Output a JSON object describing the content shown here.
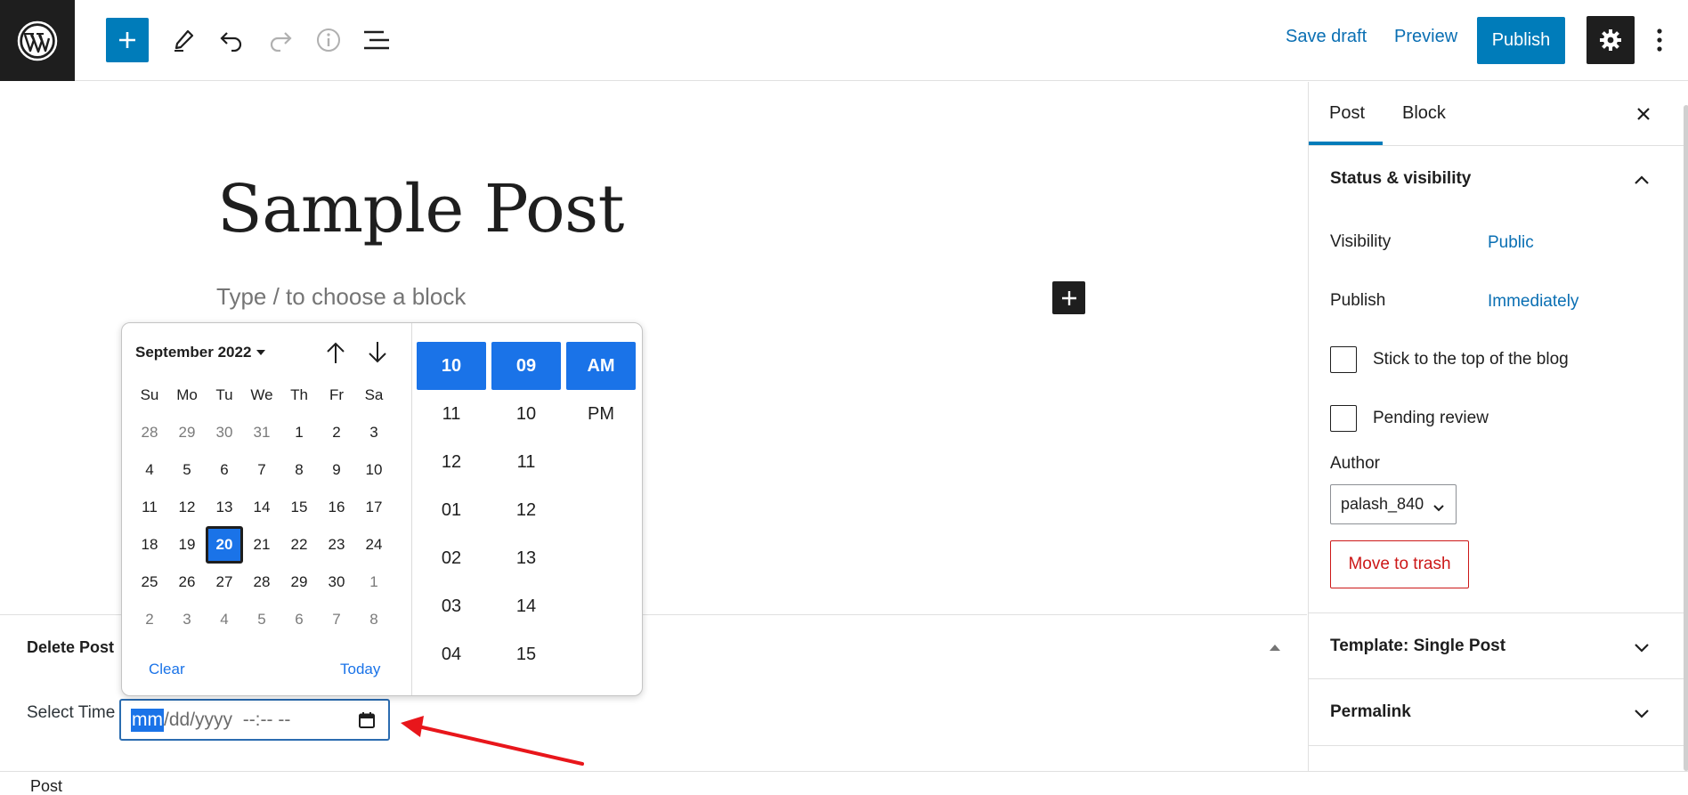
{
  "toolbar": {
    "save_draft": "Save draft",
    "preview": "Preview",
    "publish": "Publish"
  },
  "editor": {
    "title": "Sample Post",
    "placeholder": "Type / to choose a block"
  },
  "metabox": {
    "title": "Delete Post",
    "select_time_label": "Select Time",
    "input": {
      "selected_segment": "mm",
      "rest": "/dd/yyyy  --:-- --"
    }
  },
  "datepicker": {
    "month_label": "September 2022",
    "weekdays": [
      "Su",
      "Mo",
      "Tu",
      "We",
      "Th",
      "Fr",
      "Sa"
    ],
    "weeks": [
      [
        "28",
        "29",
        "30",
        "31",
        "1",
        "2",
        "3"
      ],
      [
        "4",
        "5",
        "6",
        "7",
        "8",
        "9",
        "10"
      ],
      [
        "11",
        "12",
        "13",
        "14",
        "15",
        "16",
        "17"
      ],
      [
        "18",
        "19",
        "20",
        "21",
        "22",
        "23",
        "24"
      ],
      [
        "25",
        "26",
        "27",
        "28",
        "29",
        "30",
        "1"
      ],
      [
        "2",
        "3",
        "4",
        "5",
        "6",
        "7",
        "8"
      ]
    ],
    "selected_day": "20",
    "clear": "Clear",
    "today": "Today",
    "hours": [
      "10",
      "11",
      "12",
      "01",
      "02",
      "03",
      "04"
    ],
    "minutes": [
      "09",
      "10",
      "11",
      "12",
      "13",
      "14",
      "15"
    ],
    "ampm": [
      "AM",
      "PM"
    ]
  },
  "sidebar": {
    "tabs": [
      "Post",
      "Block"
    ],
    "active_tab": "Post",
    "status_panel": {
      "title": "Status & visibility",
      "visibility_label": "Visibility",
      "visibility_value": "Public",
      "publish_label": "Publish",
      "publish_value": "Immediately",
      "sticky_label": "Stick to the top of the blog",
      "pending_label": "Pending review",
      "author_label": "Author",
      "author_value": "palash_840",
      "trash": "Move to trash"
    },
    "template_panel": {
      "title": "Template: Single Post"
    },
    "permalink_panel": {
      "title": "Permalink"
    }
  },
  "statusbar": {
    "label": "Post"
  },
  "colors": {
    "accent": "#007cba",
    "picker_accent": "#1a73e8",
    "danger": "#cc1818",
    "annotation_arrow": "#e8161b"
  }
}
